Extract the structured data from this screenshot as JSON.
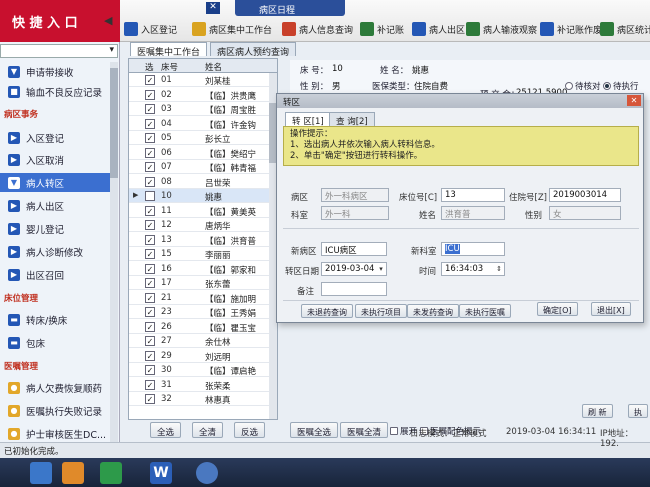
{
  "topbar": {
    "quick_entry": "快 捷 入 口",
    "window_title": "病区日程",
    "buttons": [
      {
        "label": "入区登记",
        "icon": "book-icon"
      },
      {
        "label": "病区集中工作台",
        "icon": "folder-icon"
      },
      {
        "label": "病人信息查询",
        "icon": "search-icon"
      },
      {
        "label": "补记账",
        "icon": "ledger-icon"
      },
      {
        "label": "病人出区",
        "icon": "exit-icon"
      },
      {
        "label": "病人输液观察",
        "icon": "drip-icon"
      },
      {
        "label": "补记账作废",
        "icon": "cancel-icon"
      },
      {
        "label": "病区统计报表",
        "icon": "report-icon"
      }
    ]
  },
  "sidebar": {
    "items_top": [
      "申请带接收",
      "输血不良反应记录"
    ],
    "group1": "病区事务",
    "items_g1": [
      "入区登记",
      "入区取消",
      "病人转区",
      "病人出区",
      "婴儿登记",
      "病人诊断修改",
      "出区召回"
    ],
    "group2": "床位管理",
    "items_g2": [
      "转床/换床",
      "包床"
    ],
    "group3": "医嘱管理",
    "items_g3": [
      "病人欠费恢复顺药",
      "医嘱执行失败记录",
      "护士审核医生DC..."
    ],
    "active_item": "病人转区"
  },
  "main_tabs": [
    "医嘱集中工作台",
    "病区病人预约查询"
  ],
  "patient_list": {
    "headers": [
      "选",
      "床号",
      "姓名"
    ],
    "rows": [
      {
        "bed": "01",
        "name": "刘某桂",
        "checked": true
      },
      {
        "bed": "02",
        "name": "【临】洪贵鹰",
        "checked": true
      },
      {
        "bed": "03",
        "name": "【临】周宝胜",
        "checked": true
      },
      {
        "bed": "04",
        "name": "【临】许金钩",
        "checked": true
      },
      {
        "bed": "05",
        "name": "彭长立",
        "checked": true
      },
      {
        "bed": "06",
        "name": "【临】樊绍宁",
        "checked": true
      },
      {
        "bed": "07",
        "name": "【临】韩青福",
        "checked": true
      },
      {
        "bed": "08",
        "name": "吕世荣",
        "checked": true
      },
      {
        "bed": "10",
        "name": "姚惠",
        "checked": false
      },
      {
        "bed": "11",
        "name": "【临】黄美英",
        "checked": true
      },
      {
        "bed": "12",
        "name": "唐炳华",
        "checked": true
      },
      {
        "bed": "13",
        "name": "【临】洪育普",
        "checked": true
      },
      {
        "bed": "15",
        "name": "李丽丽",
        "checked": true
      },
      {
        "bed": "16",
        "name": "【临】郭家和",
        "checked": true
      },
      {
        "bed": "17",
        "name": "张东蕾",
        "checked": true
      },
      {
        "bed": "21",
        "name": "【临】施加明",
        "checked": true
      },
      {
        "bed": "23",
        "name": "【临】王秀娟",
        "checked": true
      },
      {
        "bed": "26",
        "name": "【临】瞿玉宝",
        "checked": true
      },
      {
        "bed": "27",
        "name": "余仕林",
        "checked": true
      },
      {
        "bed": "29",
        "name": "刘远明",
        "checked": true
      },
      {
        "bed": "30",
        "name": "【临】谭启艳",
        "checked": true
      },
      {
        "bed": "31",
        "name": "张荣柔",
        "checked": true
      },
      {
        "bed": "32",
        "name": "林惠真",
        "checked": true
      }
    ]
  },
  "bottom_buttons": [
    "全选",
    "全清",
    "反选",
    "医嘱全选",
    "医嘱全清"
  ],
  "expand_label": "展开",
  "color_hint_label": "医嘱配色提示",
  "patient_info": {
    "bed_label": "床 号：",
    "bed": "10",
    "name_label": "姓 名：",
    "name": "姚惠",
    "sex_label": "性 别：",
    "sex": "男",
    "insurance_label": "医保类型：",
    "insurance": "住院自费",
    "prepay_label": "预 交 金：",
    "prepay": "25121.5900"
  },
  "right_options": {
    "radio1": "待核对",
    "radio2": "待执行",
    "radio3": "待执"
  },
  "dialog": {
    "title": "转区",
    "tabs": [
      "转 区[1]",
      "查 询[2]"
    ],
    "hint_title": "操作提示：",
    "hint_lines": [
      "1、选出病人并依次输入病人转科信息。",
      "2、单击\"确定\"按钮进行转科操作。"
    ],
    "ward_label": "病区",
    "ward": "外一科病区",
    "bed_label": "床位号[C]",
    "bed": "13",
    "admission_label": "住院号[Z]",
    "admission": "2019003014",
    "dept_label": "科室",
    "dept": "外一科",
    "name_label": "姓名",
    "name": "洪育普",
    "sex_label": "性别",
    "sex": "女",
    "new_ward_label": "新病区",
    "new_ward": "ICU病区",
    "new_dept_label": "新科室",
    "new_dept": "ICU",
    "date_label": "转区日期",
    "date": "2019-03-04",
    "time_label": "时间",
    "time": "16:34:03",
    "note_label": "备注",
    "note": "",
    "buttons": [
      "未退药查询",
      "未执行项目",
      "未发药查询",
      "未执行医嘱",
      "确定[O]",
      "退出[X]"
    ]
  },
  "right_buttons": [
    "刷 新",
    "执"
  ],
  "status": {
    "log_mode": "日志模式：正常模式",
    "datetime": "2019-03-04 16:34:11",
    "ip": "IP地址：192.",
    "init_text": "已初始化完成。"
  }
}
